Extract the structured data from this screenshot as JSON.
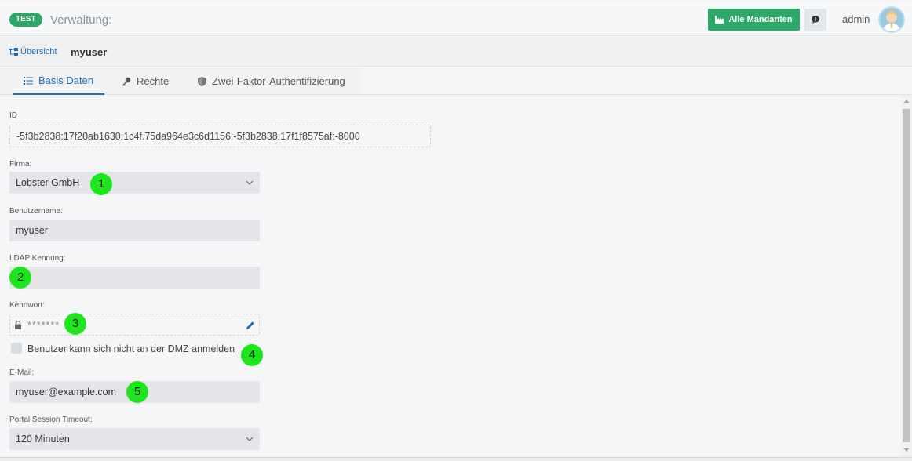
{
  "header": {
    "badge": "TEST",
    "title": "Verwaltung:",
    "all_clients_label": "Alle Mandanten",
    "user": "admin"
  },
  "breadcrumb": {
    "overview": "Übersicht",
    "current": "myuser"
  },
  "tabs": [
    {
      "label": "Basis Daten",
      "icon": "list-icon",
      "active": true
    },
    {
      "label": "Rechte",
      "icon": "key-icon",
      "active": false
    },
    {
      "label": "Zwei-Faktor-Authentifizierung",
      "icon": "shield-icon",
      "active": false
    }
  ],
  "form": {
    "id_label": "ID",
    "id_value": "-5f3b2838:17f20ab1630:1c4f.75da964e3c6d1156:-5f3b2838:17f1f8575af:-8000",
    "company_label": "Firma:",
    "company_value": "Lobster GmbH",
    "username_label": "Benutzername:",
    "username_value": "myuser",
    "ldap_label": "LDAP Kennung:",
    "ldap_value": "",
    "password_label": "Kennwort:",
    "password_value": "*******",
    "dmz_checkbox_label": "Benutzer kann sich nicht an der DMZ anmelden",
    "dmz_checked": false,
    "email_label": "E-Mail:",
    "email_value": "myuser@example.com",
    "timeout_label": "Portal Session Timeout:",
    "timeout_value": "120 Minuten"
  },
  "markers": [
    "1",
    "2",
    "3",
    "4",
    "5"
  ],
  "colors": {
    "accent_green": "#2ea868",
    "link_blue": "#1d6fb5",
    "marker_green": "#1ee61e"
  }
}
